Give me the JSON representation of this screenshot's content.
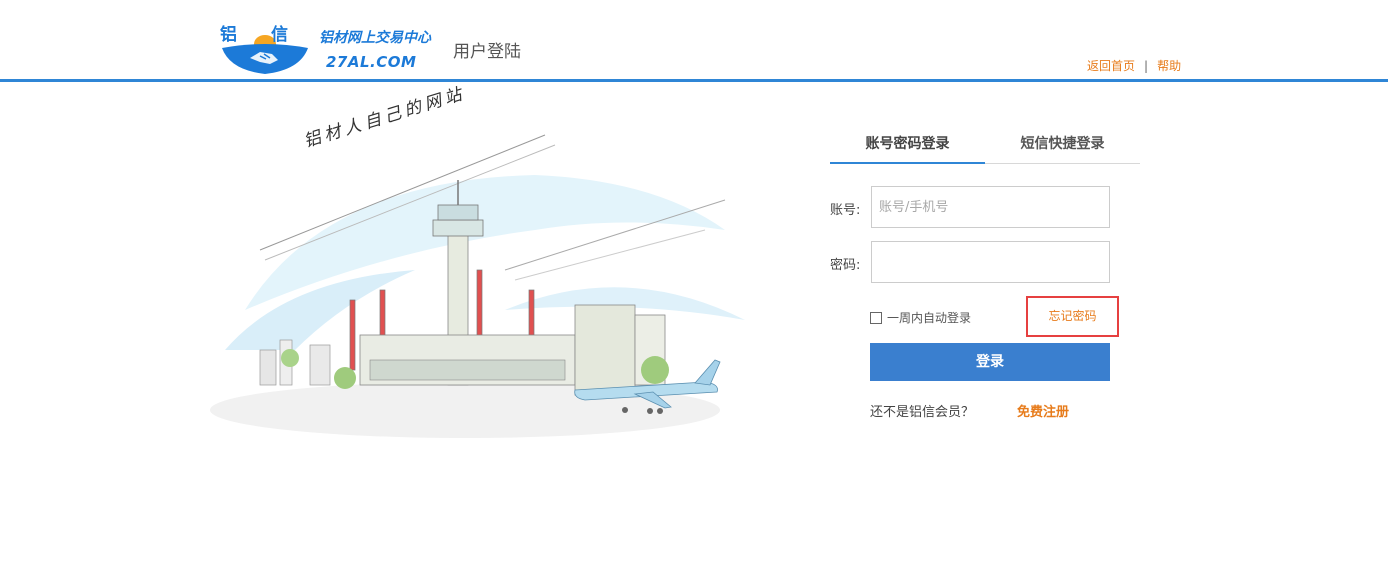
{
  "header": {
    "logo_cn": "铝信",
    "logo_slogan": "铝材网上交易中心",
    "logo_domain": "27AL.COM",
    "subtitle": "用户登陆",
    "links": [
      {
        "label": "返回首页"
      },
      {
        "label": "帮助"
      }
    ],
    "link_separator": "|"
  },
  "illustration": {
    "caption": "铝材人自己的网站"
  },
  "login": {
    "tabs": [
      {
        "label": "账号密码登录",
        "active": true
      },
      {
        "label": "短信快捷登录",
        "active": false
      }
    ],
    "account_label": "账号:",
    "account_placeholder": "账号/手机号",
    "password_label": "密码:",
    "remember_label": "一周内自动登录",
    "forgot_label": "忘记密码",
    "submit_label": "登录",
    "not_member_text": "还不是铝信会员？",
    "register_label": "免费注册"
  },
  "colors": {
    "brand_blue": "#2f86d6",
    "button_blue": "#3a7fcf",
    "link_orange": "#e77c1c",
    "highlight_red": "#e64040"
  }
}
